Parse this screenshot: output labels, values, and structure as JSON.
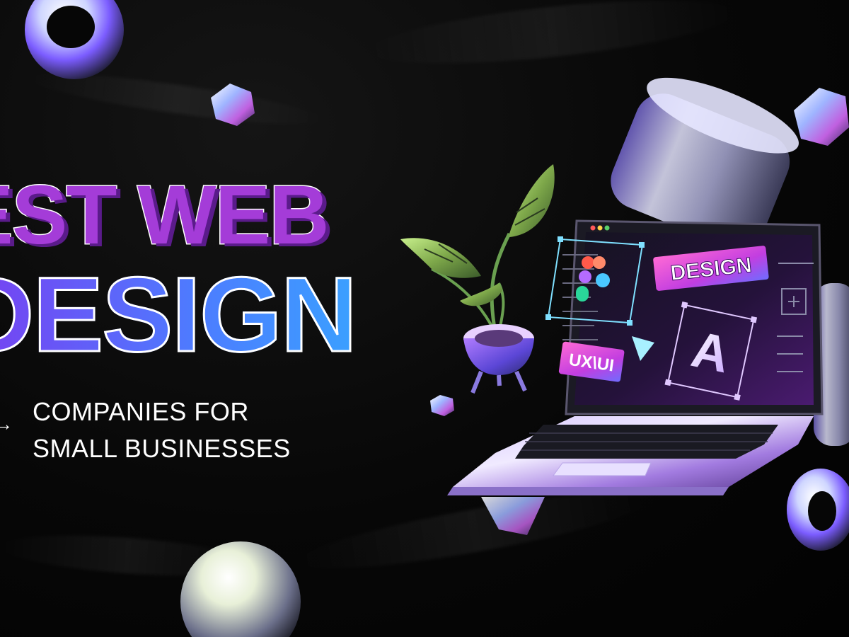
{
  "headline": {
    "line1": "EST WEB",
    "line2": "DESIGN"
  },
  "subheadline": {
    "arrow": "→",
    "line1": "COMPANIES FOR",
    "line2": "SMALL BUSINESSES"
  },
  "screen_labels": {
    "design_badge": "DESIGN",
    "uxui_badge": "UX\\UI",
    "letter_card": "A"
  },
  "colors": {
    "background": "#050505",
    "purple": "#a43cd8",
    "blue": "#3aa0ff",
    "magenta_badge": "#e040c0"
  }
}
